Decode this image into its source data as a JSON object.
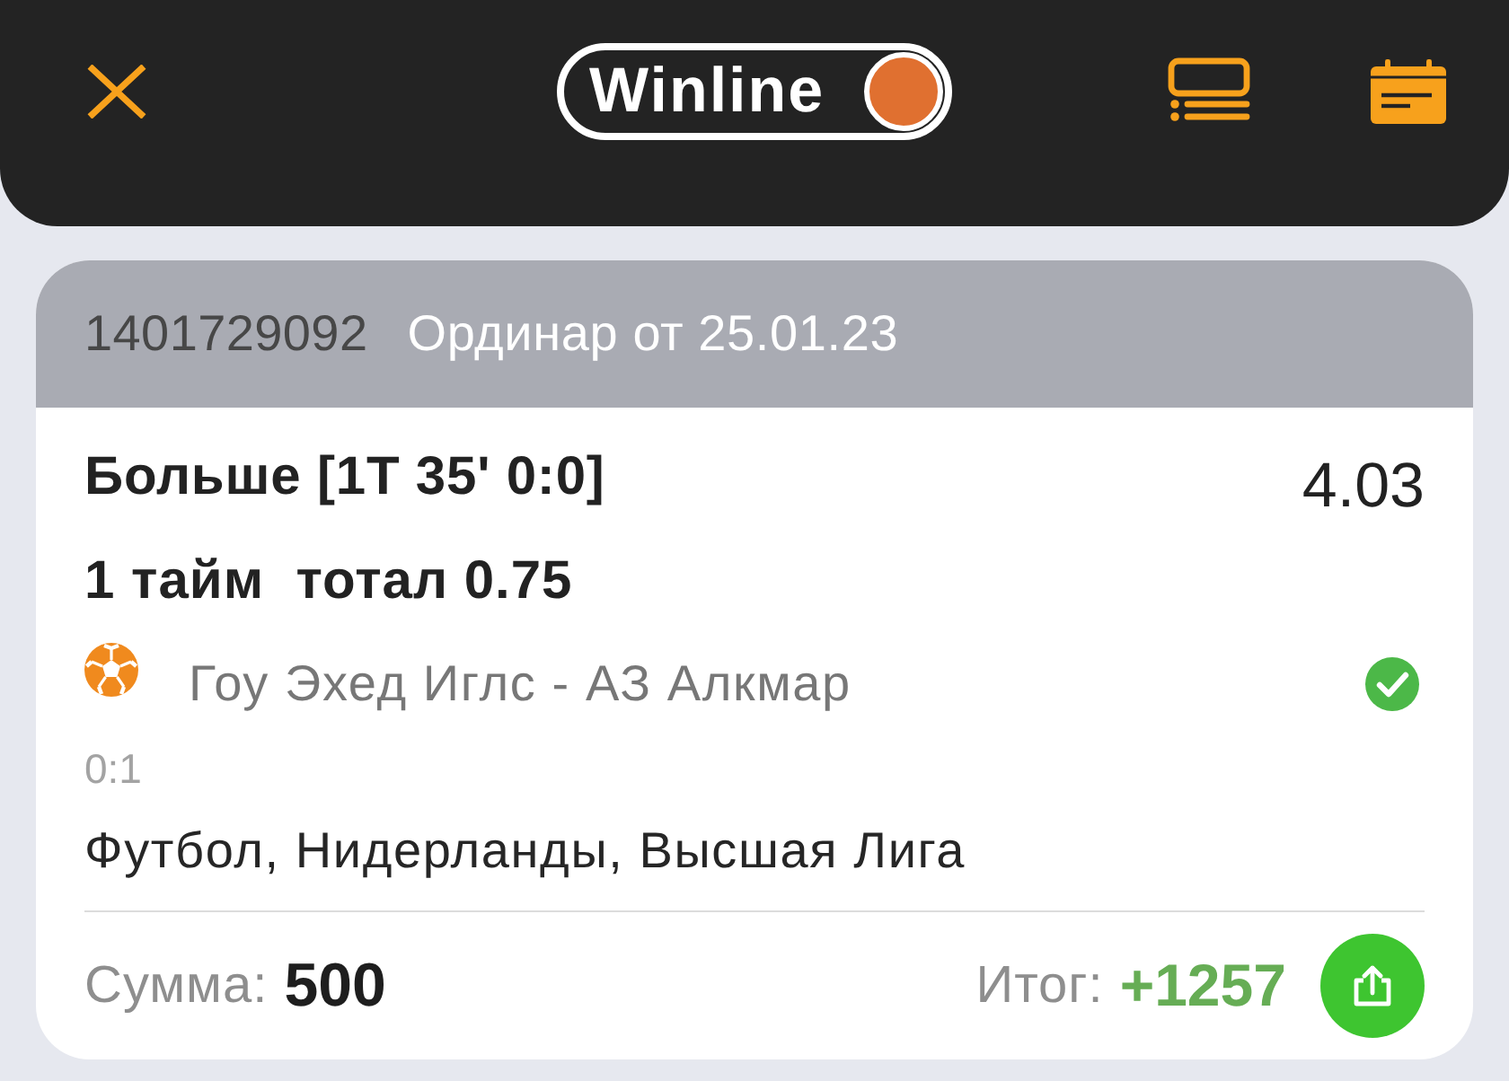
{
  "header": {
    "logo": "Winline"
  },
  "bet": {
    "id": "1401729092",
    "title": "Ординар от 25.01.23",
    "selection": "Больше [1Т 35' 0:0]",
    "odds": "4.03",
    "market": "1 тайм  тотал 0.75",
    "event": "Гоу Эхед Иглс - АЗ Алкмар",
    "won": true,
    "score": "0:1",
    "league": "Футбол, Нидерланды, Высшая Лига"
  },
  "footer": {
    "stake_label": "Сумма:",
    "stake": "500",
    "result_label": "Итог:",
    "result": "+1257"
  }
}
